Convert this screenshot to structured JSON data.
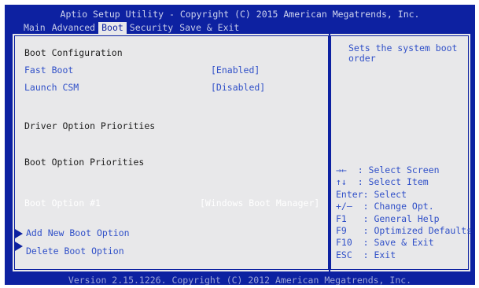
{
  "header": {
    "title": "Aptio Setup Utility - Copyright (C) 2015 American Megatrends, Inc."
  },
  "menu": {
    "tabs": [
      "Main",
      "Advanced",
      "Boot",
      "Security",
      "Save & Exit"
    ],
    "active": "Boot"
  },
  "settings": {
    "boot_configuration": "Boot Configuration",
    "fast_boot_label": "Fast Boot",
    "fast_boot_value": "[Enabled]",
    "launch_csm_label": "Launch CSM",
    "launch_csm_value": "[Disabled]",
    "driver_option_priorities": "Driver Option Priorities",
    "boot_option_priorities": "Boot Option Priorities",
    "boot_option_1_label": "Boot Option #1",
    "boot_option_1_value": "[Windows Boot Manager]",
    "add_new_boot_option": "Add New Boot Option",
    "delete_boot_option": "Delete Boot Option"
  },
  "help": {
    "description": "Sets the system boot order",
    "keys": [
      "→←  : Select Screen",
      "↑↓  : Select Item",
      "Enter: Select",
      "+/—  : Change Opt.",
      "F1   : General Help",
      "F9   : Optimized Defaults",
      "F10  : Save & Exit",
      "ESC  : Exit"
    ]
  },
  "footer": {
    "version": "Version 2.15.1226. Copyright (C) 2012 American Megatrends, Inc."
  },
  "colors": {
    "background_blue": "#0d21a1",
    "panel_gray": "#e8e8ea",
    "item_blue": "#3050c8"
  }
}
